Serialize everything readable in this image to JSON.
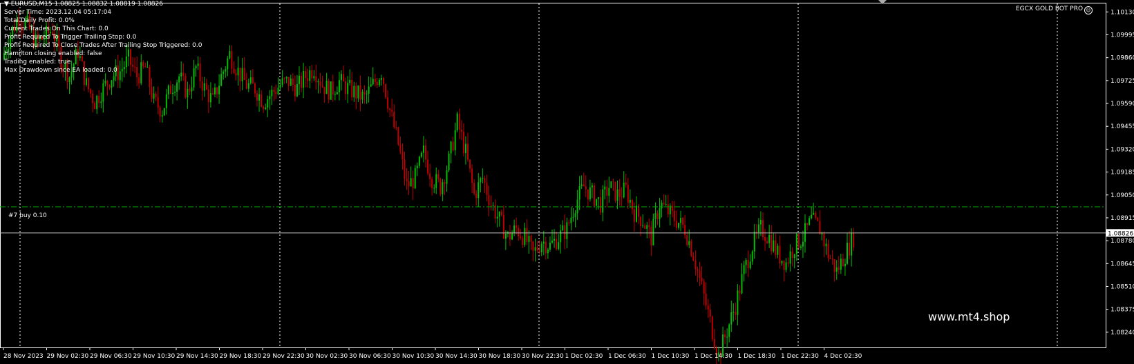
{
  "chart_data": {
    "type": "candlestick",
    "title": "EURUSD,M15",
    "ohlc_header": "1.08825 1.08832 1.08819 1.08826",
    "ylim": [
      1.0815,
      1.1018
    ],
    "y_ticks": [
      "1.10130",
      "1.09995",
      "1.09860",
      "1.09725",
      "1.09590",
      "1.09455",
      "1.09320",
      "1.09185",
      "1.09050",
      "1.08915",
      "1.08780",
      "1.08645",
      "1.08510",
      "1.08375",
      "1.08240"
    ],
    "x_ticks": [
      "28 Nov 2023",
      "29 Nov 02:30",
      "29 Nov 06:30",
      "29 Nov 10:30",
      "29 Nov 14:30",
      "29 Nov 18:30",
      "29 Nov 22:30",
      "30 Nov 02:30",
      "30 Nov 06:30",
      "30 Nov 10:30",
      "30 Nov 14:30",
      "30 Nov 18:30",
      "30 Nov 22:30",
      "1 Dec 02:30",
      "1 Dec 06:30",
      "1 Dec 10:30",
      "1 Dec 14:30",
      "1 Dec 18:30",
      "1 Dec 22:30",
      "4 Dec 02:30"
    ],
    "current_price": 1.08826,
    "current_price_label": "1.08826",
    "order_price": 1.0898,
    "path": [
      1.0985,
      1.1,
      1.101,
      1.1005,
      1.0995,
      1.0998,
      1.1003,
      1.0985,
      1.0975,
      1.099,
      1.097,
      1.096,
      1.0968,
      1.0975,
      1.0978,
      1.0985,
      1.0975,
      1.098,
      1.096,
      1.0955,
      1.0968,
      1.0975,
      1.0965,
      1.098,
      1.0968,
      1.096,
      1.0975,
      1.0988,
      1.0978,
      1.097,
      1.0968,
      1.096,
      1.0965,
      1.097,
      1.0972,
      1.0968,
      1.0975,
      1.098,
      1.097,
      1.0966,
      1.0972,
      1.0968,
      1.0965,
      1.0962,
      1.097,
      1.0978,
      1.0955,
      1.0935,
      1.091,
      1.0915,
      1.093,
      1.0915,
      1.091,
      1.0925,
      1.0948,
      1.093,
      1.0905,
      1.0915,
      1.09,
      1.089,
      1.088,
      1.0885,
      1.088,
      1.087,
      1.0878,
      1.0875,
      1.088,
      1.0885,
      1.09,
      1.091,
      1.0905,
      1.09,
      1.091,
      1.0905,
      1.0908,
      1.0895,
      1.089,
      1.088,
      1.09,
      1.0895,
      1.089,
      1.0885,
      1.087,
      1.085,
      1.083,
      1.081,
      1.0825,
      1.084,
      1.086,
      1.0875,
      1.0885,
      1.088,
      1.087,
      1.0865,
      1.0875,
      1.088,
      1.089,
      1.0885,
      1.087,
      1.086,
      1.087,
      1.088
    ],
    "hlines": [
      "1.08826",
      "1.0898"
    ]
  },
  "info_lines": [
    "Server Time: 2023.12.04 05:17:04",
    "Total Daily Profit: 0.0%",
    "Current Trades On This Chart: 0.0",
    "Profit Required To Trigger Trailing Stop: 0.0",
    "Profit Required To Close Trades After Trailing Stop Triggered: 0.0",
    "Hamilton closing enabled: false",
    "Trading enabled: true",
    "Max Drawdown since EA loaded: 0.0"
  ],
  "ea_name": "EGCX GOLD BOT PRO",
  "order_label": "#7 buy 0.10",
  "watermark": "www.mt4.shop",
  "colors": {
    "bull": "#00c000",
    "bear": "#c00000",
    "grid": "#ffffff",
    "order": "#00b000",
    "price": "#c0c0c0",
    "background": "#000000"
  }
}
